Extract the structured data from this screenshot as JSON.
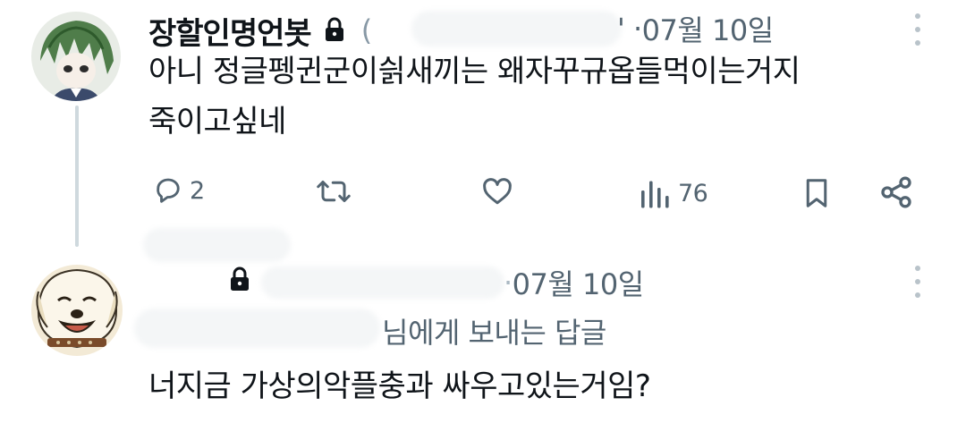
{
  "tweet1": {
    "display_name": "장할인명언봇",
    "handle_prefix": "(",
    "date_prefix": "' · ",
    "date": "07월 10일",
    "text_line1": "아니 정글펭귄군이싉새끼는 왜자꾸규옵들먹이는거지",
    "text_line2": "죽이고싶네",
    "actions": {
      "reply_count": "2",
      "views_count": "76"
    }
  },
  "tweet2": {
    "date_prefix": "· ",
    "date": "07월 10일",
    "reply_to": "님에게 보내는 답글",
    "text": "너지금 가상의악플충과 싸우고있는거임?"
  },
  "icons": {
    "reply": "comment-icon",
    "retweet": "retweet-icon",
    "like": "heart-icon",
    "views": "analytics-icon",
    "bookmark": "bookmark-icon",
    "share": "share-icon",
    "lock": "lock-icon",
    "more": "more-vertical-icon"
  },
  "colors": {
    "text": "#0f1419",
    "secondary": "#536471",
    "thread_line": "#cfd9de"
  }
}
